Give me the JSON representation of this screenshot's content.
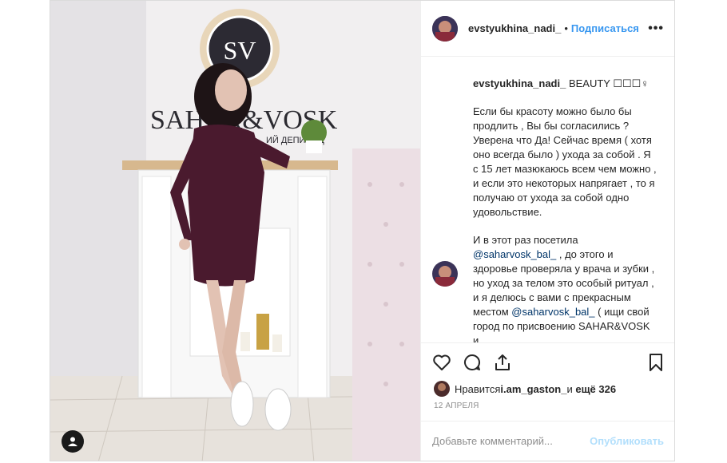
{
  "post": {
    "username": "evstyukhina_nadi_",
    "dot": "•",
    "follow": "Подписаться",
    "more": "•••"
  },
  "caption": {
    "username": "evstyukhina_nadi_",
    "title": " BEAUTY ☐☐☐♀",
    "para1": "Если бы красоту можно было бы продлить , Вы бы согласились ? Уверена что Да! Сейчас время ( хотя оно всегда было ) ухода за собой . Я с 15 лет мазюкаюсь всем чем можно , и если это некоторых напрягает , то я получаю от ухода за собой одно удовольствие.",
    "para2_a": "И в этот раз посетила ",
    "mention1": "@saharvosk_bal_",
    "para2_b": " , до этого и здоровье проверяла у врача и зубки , но уход за телом это особый ритуал , и я делюсь с вами с прекрасным местом ",
    "mention2": "@saharvosk_bal_",
    "para2_c": " ( ищи свой город по присвоению SAHAR&VOSK и"
  },
  "photo_sign": {
    "monogram": "SV",
    "brand": "SAHAR&VOSK",
    "tagline": "ИЙ ДЕПИЛЯЦ"
  },
  "likes": {
    "prefix": "Нравится ",
    "user": "i.am_gaston_",
    "middle": " и ",
    "count": "ещё 326"
  },
  "date": "12 АПРЕЛЯ",
  "comment_box": {
    "placeholder": "Добавьте комментарий...",
    "publish": "Опубликовать"
  },
  "icons": [
    "heart-icon",
    "comment-icon",
    "share-icon",
    "bookmark-icon",
    "more-icon",
    "user-tag-icon"
  ],
  "colors": {
    "link": "#3897f0",
    "mention": "#003569",
    "muted": "#8e8e8e",
    "dress": "#4a1a2e"
  }
}
